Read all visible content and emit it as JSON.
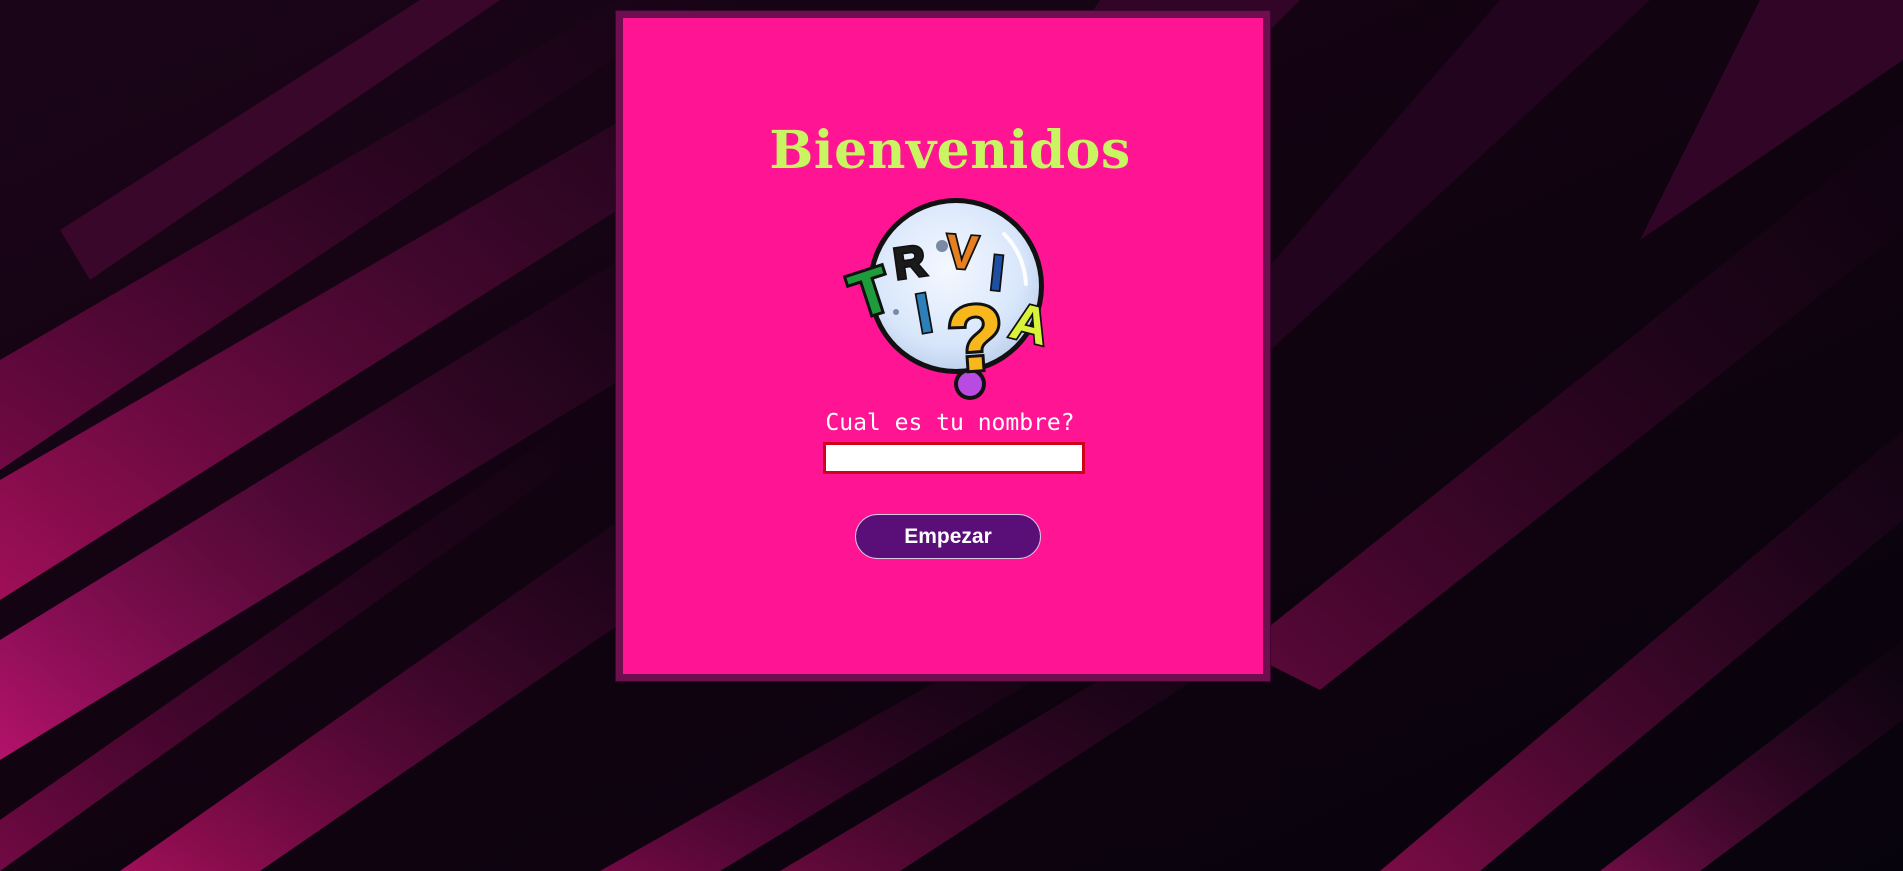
{
  "page": {
    "title": "Bienvenidos",
    "prompt": "Cual es tu nombre?",
    "name_input": {
      "value": "",
      "placeholder": ""
    },
    "start_button_label": "Empezar"
  },
  "logo": {
    "icon": "trivia-logo",
    "letters": [
      "T",
      "R",
      "I",
      "V",
      "I",
      "A"
    ],
    "symbol": "?"
  },
  "colors": {
    "card": "#ff1493",
    "card_border": "#6e0e4e",
    "title": "#c9f562",
    "button": "#5a0f78",
    "input_border": "#d0021b"
  }
}
